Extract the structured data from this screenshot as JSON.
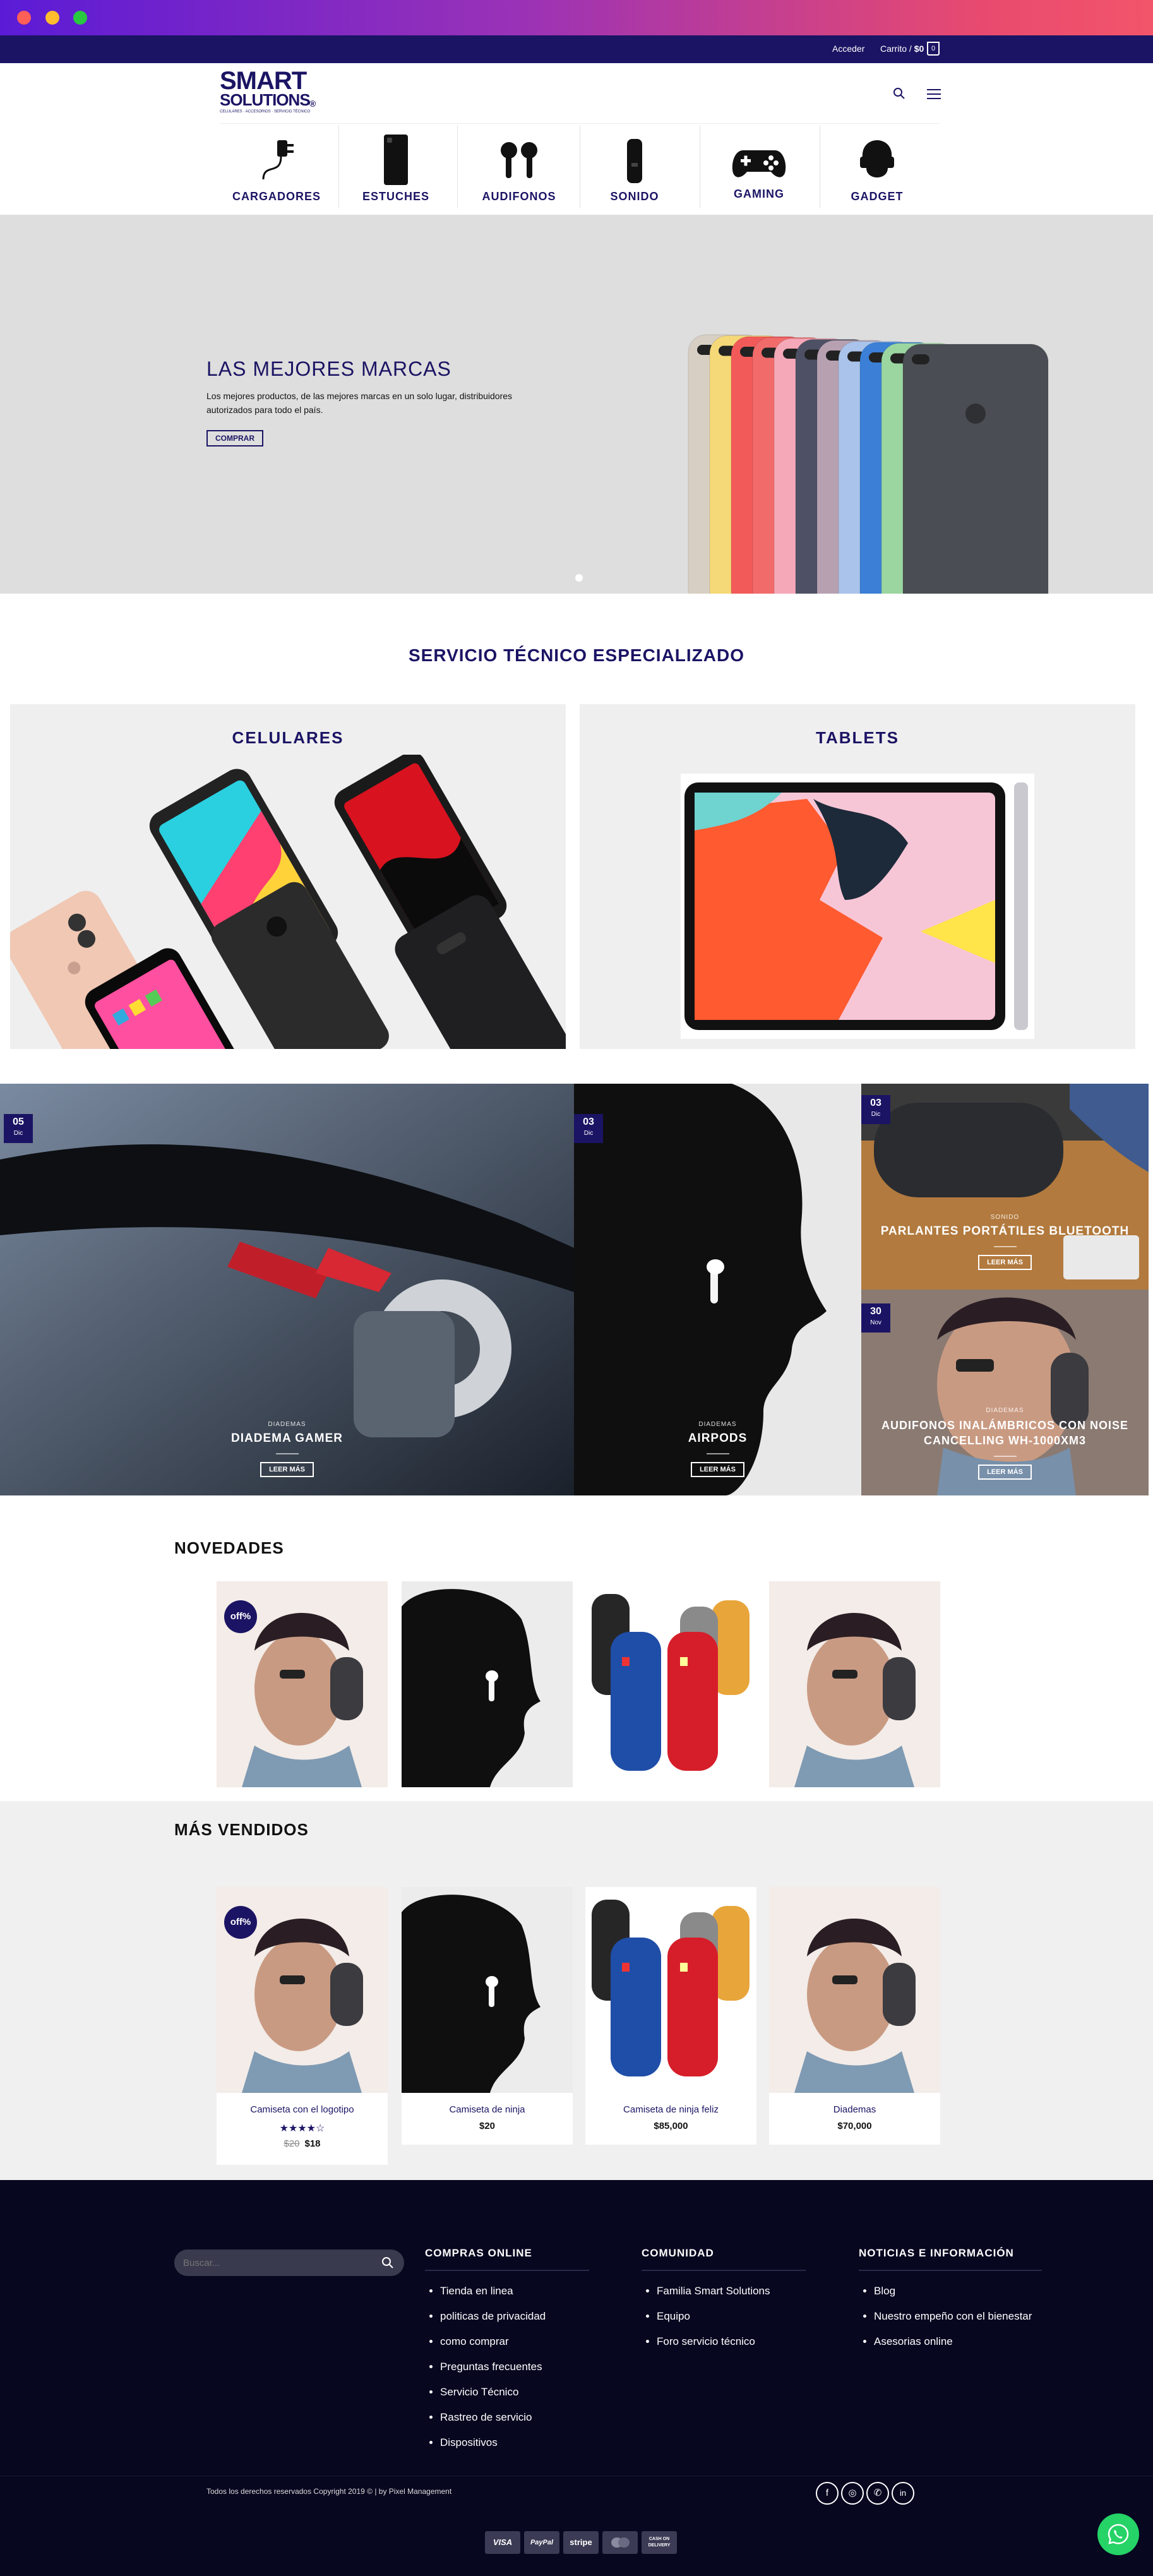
{
  "topbar": {
    "login": "Acceder",
    "cart": "Carrito",
    "cart_sep": " / ",
    "cart_total": "$0",
    "cart_count": "0"
  },
  "logo": {
    "line1": "SMART",
    "line2": "SOLUTIONS",
    "reg": "®",
    "tagline": "CELULARES · ACCESORIOS · SERVICIO TÉCNICO"
  },
  "categories": [
    {
      "label": "CARGADORES",
      "icon": "charger-icon"
    },
    {
      "label": "ESTUCHES",
      "icon": "phone-case-icon"
    },
    {
      "label": "AUDIFONOS",
      "icon": "earbuds-icon"
    },
    {
      "label": "SONIDO",
      "icon": "speaker-icon"
    },
    {
      "label": "GAMING",
      "icon": "gamepad-icon"
    },
    {
      "label": "GADGET",
      "icon": "vr-headset-icon"
    }
  ],
  "hero": {
    "title": "LAS MEJORES MARCAS",
    "text": "Los mejores productos, de las mejores marcas en un solo lugar, distribuidores autorizados para todo el país.",
    "button": "COMPRAR",
    "case_colors": [
      "#d8cfc4",
      "#f5d978",
      "#f25a5a",
      "#f26b6b",
      "#f5a8b8",
      "#4e5166",
      "#b7a1b1",
      "#a9c3ea",
      "#3b7fd6",
      "#9bd6a1",
      "#4a4d53"
    ]
  },
  "service": {
    "title": "SERVICIO TÉCNICO ESPECIALIZADO",
    "cards": [
      {
        "title": "CELULARES"
      },
      {
        "title": "TABLETS"
      }
    ]
  },
  "blog": [
    {
      "day": "05",
      "month": "Dic",
      "category": "DIADEMAS",
      "title": "DIADEMA GAMER",
      "button": "LEER MÁS"
    },
    {
      "day": "03",
      "month": "Dic",
      "category": "DIADEMAS",
      "title": "AIRPODS",
      "button": "LEER MÁS"
    },
    {
      "day": "03",
      "month": "Dic",
      "category": "SONIDO",
      "title": "PARLANTES PORTÁTILES BLUETOOTH",
      "button": "LEER MÁS"
    },
    {
      "day": "30",
      "month": "Nov",
      "category": "DIADEMAS",
      "title": "AUDIFONOS INALÁMBRICOS CON NOISE CANCELLING WH-1000XM3",
      "button": "LEER MÁS"
    }
  ],
  "novedades": {
    "title": "NOVEDADES",
    "badge": "off%"
  },
  "vendidos": {
    "title": "MÁS VENDIDOS",
    "badge": "off%",
    "products": [
      {
        "name": "Camiseta con el logotipo",
        "old_price": "$20",
        "price": "$18",
        "rating": 4
      },
      {
        "name": "Camiseta de ninja",
        "price": "$20"
      },
      {
        "name": "Camiseta de ninja feliz",
        "price": "$85,000"
      },
      {
        "name": "Diademas",
        "price": "$70,000"
      }
    ]
  },
  "footer": {
    "search_placeholder": "Buscar...",
    "col1": {
      "title": "COMPRAS ONLINE",
      "items": [
        "Tienda en linea",
        "politicas de privacidad",
        "como comprar",
        "Preguntas frecuentes",
        "Servicio Técnico",
        "Rastreo de servicio",
        "Dispositivos"
      ]
    },
    "col2": {
      "title": "COMUNIDAD",
      "items": [
        "Familia Smart Solutions",
        "Equipo",
        "Foro servicio técnico"
      ]
    },
    "col3": {
      "title": "NOTICIAS E INFORMACIÓN",
      "items": [
        "Blog",
        "Nuestro empeño con el bienestar",
        "Asesorias online"
      ]
    },
    "copyright": "Todos los derechos reservados Copyright 2019 © | by Pixel Management",
    "payments": [
      "VISA",
      "PayPal",
      "stripe",
      "MC",
      "CASH ON DELIVERY"
    ]
  }
}
